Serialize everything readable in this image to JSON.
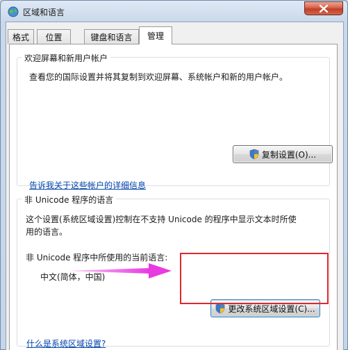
{
  "window": {
    "title": "区域和语言",
    "title_icon": "globe-icon",
    "close_icon": "close-icon"
  },
  "tabs": [
    {
      "label": "格式",
      "active": false
    },
    {
      "label": "位置",
      "active": false
    },
    {
      "label": "键盘和语言",
      "active": false
    },
    {
      "label": "管理",
      "active": true
    }
  ],
  "welcome": {
    "legend": "欢迎屏幕和新用户帐户",
    "description": "查看您的国际设置并将其复制到欢迎屏幕、系统帐户和新的用户帐户。",
    "copy_button": "复制设置(O)...",
    "link": "告诉我关于这些帐户的详细信息"
  },
  "unicode": {
    "legend": "非 Unicode 程序的语言",
    "description_line1": "这个设置(系统区域设置)控制在不支持 Unicode 的程序中显示文本时所使",
    "description_line2": "用的语言。",
    "current_label": "非 Unicode 程序中所使用的当前语言:",
    "current_value": "中文(简体，中国)",
    "change_button": "更改系统区域设置(C)...",
    "link": "什么是系统区域设置?"
  },
  "colors": {
    "highlight_border": "#e0282c",
    "arrow": "#e83be0",
    "link": "#0645ad"
  }
}
